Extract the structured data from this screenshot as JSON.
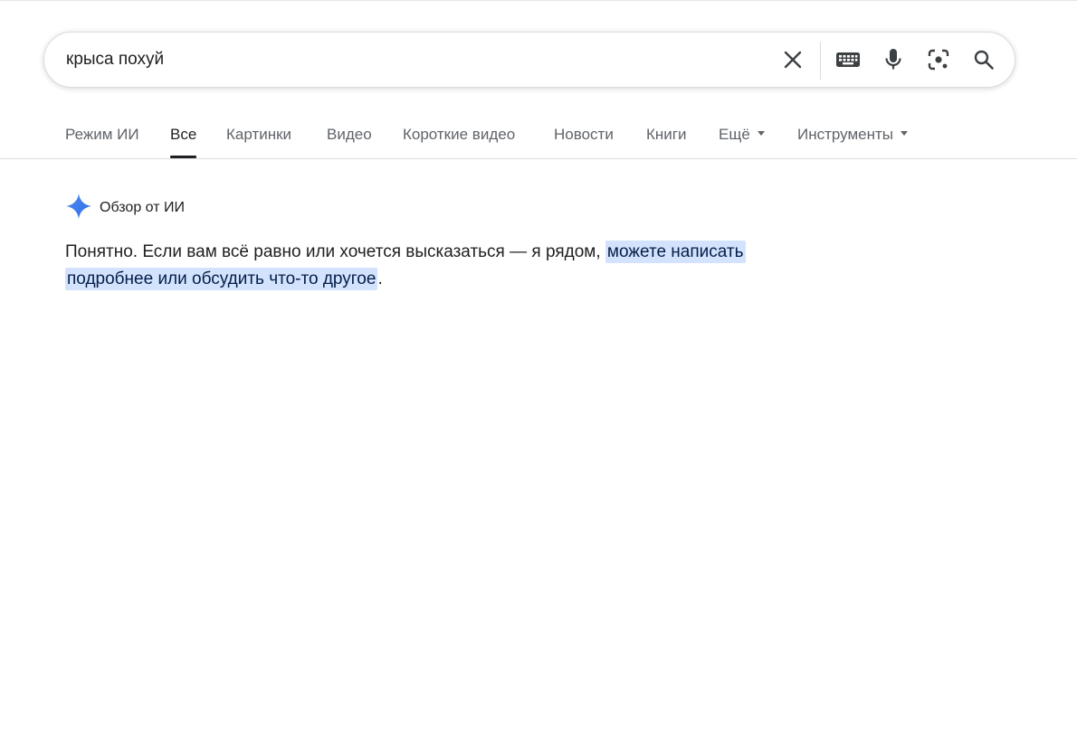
{
  "search": {
    "query": "крыса похуй",
    "icons": {
      "clear": "close-icon",
      "keyboard": "keyboard-icon",
      "voice": "microphone-icon",
      "lens": "camera-lens-icon",
      "search": "search-icon"
    }
  },
  "tabs": [
    {
      "label": "Режим ИИ",
      "active": false
    },
    {
      "label": "Все",
      "active": true
    },
    {
      "label": "Картинки",
      "active": false
    },
    {
      "label": "Видео",
      "active": false
    },
    {
      "label": "Короткие видео",
      "active": false
    },
    {
      "label": "Новости",
      "active": false
    },
    {
      "label": "Книги",
      "active": false
    },
    {
      "label": "Ещё",
      "active": false,
      "dropdown": true
    },
    {
      "label": "Инструменты",
      "active": false,
      "dropdown": true
    }
  ],
  "ai_overview": {
    "icon": "sparkle-icon",
    "title": "Обзор от ИИ",
    "text_plain": "Понятно. Если вам всё равно или хочется высказаться — я рядом, ",
    "text_highlight_1": "можете написать",
    "text_highlight_2": "подробнее или обсудить что-то другое",
    "text_end": "."
  },
  "colors": {
    "accent_sparkle": "#4285f4",
    "highlight_bg": "#d3e3fd",
    "text_primary": "#202124",
    "text_secondary": "#5f6368"
  }
}
